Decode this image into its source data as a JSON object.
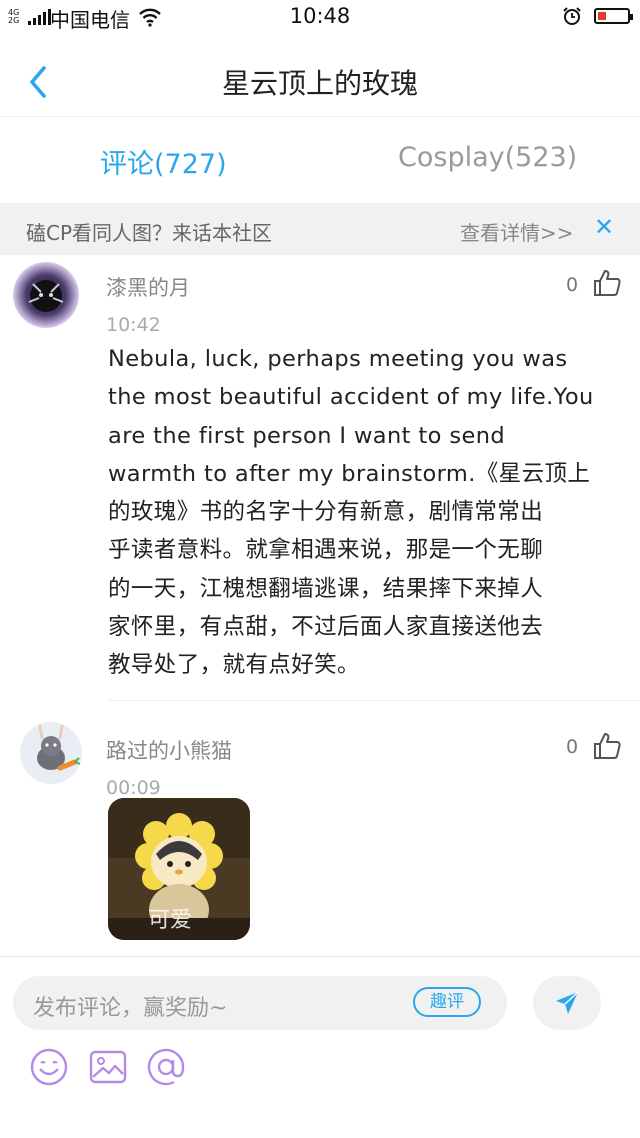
{
  "status_bar": {
    "network_top": "4G",
    "network_bottom": "2G",
    "carrier": "中国电信",
    "time": "10:48"
  },
  "header": {
    "title": "星云顶上的玫瑰"
  },
  "tabs": [
    {
      "label": "评论(727)",
      "active": true
    },
    {
      "label": "Cosplay(523)",
      "active": false
    }
  ],
  "banner": {
    "text": "磕CP看同人图？来话本社区",
    "link": "查看详情>>"
  },
  "comments": [
    {
      "username": "漆黑的月",
      "time": "10:42",
      "likes": "0",
      "lines": [
        "Nebula, luck, perhaps meeting you was",
        "the most beautiful accident of my life.You",
        "are the first person I want to send",
        "warmth to after my brainstorm.《星云顶上",
        "的玫瑰》书的名字十分有新意，剧情常常出",
        "乎读者意料。就拿相遇来说，那是一个无聊",
        "的一天，江槐想翻墙逃课，结果摔下来掉人",
        "家怀里，有点甜，不过后面人家直接送他去",
        "教导处了，就有点好笑。"
      ]
    },
    {
      "username": "路过的小熊猫",
      "time": "00:09",
      "likes": "0",
      "sticker_caption": "可爱"
    }
  ],
  "composer": {
    "placeholder": "发布评论，赢奖励~",
    "quping_label": "趣评",
    "tools": [
      "emoji-icon",
      "image-icon",
      "mention-icon"
    ]
  },
  "colors": {
    "accent": "#2aa7ec",
    "tool_purple": "#b58ae6"
  }
}
